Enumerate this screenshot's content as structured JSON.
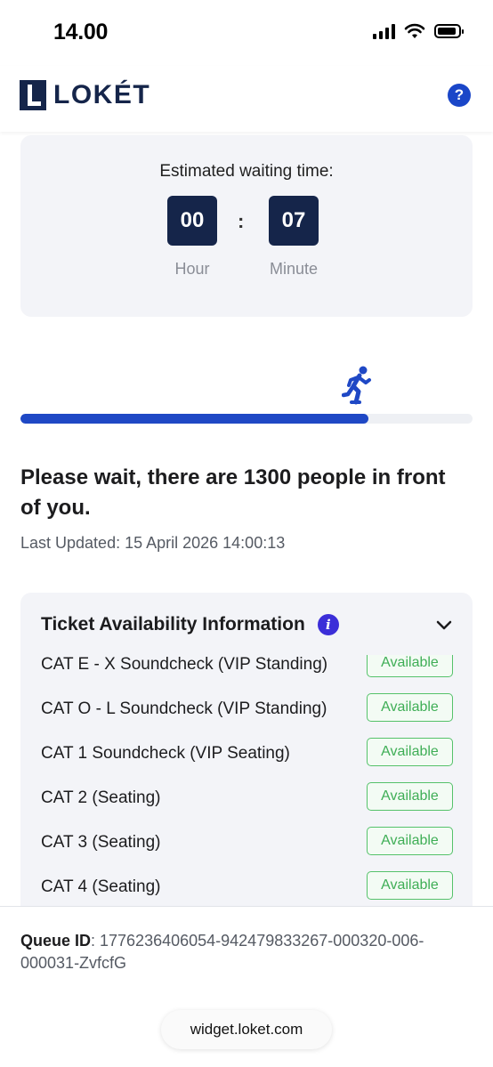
{
  "status_bar": {
    "time": "14.00"
  },
  "header": {
    "brand": "LOKÉT",
    "help_icon": "?"
  },
  "waiting": {
    "title": "Estimated waiting time:",
    "hours": "00",
    "minutes": "07",
    "separator": ":",
    "hour_label": "Hour",
    "minute_label": "Minute"
  },
  "progress": {
    "fraction": 0.77,
    "color": "#1f48c5"
  },
  "queue": {
    "message": "Please wait, there are 1300 people in front of you.",
    "last_updated": "Last Updated: 15 April 2026 14:00:13"
  },
  "tickets": {
    "title": "Ticket Availability Information",
    "info_icon": "i",
    "items": [
      {
        "name": "CAT E - X Soundcheck (VIP Standing)",
        "status": "Available"
      },
      {
        "name": "CAT O - L Soundcheck (VIP Standing)",
        "status": "Available"
      },
      {
        "name": "CAT 1 Soundcheck (VIP Seating)",
        "status": "Available"
      },
      {
        "name": "CAT 2 (Seating)",
        "status": "Available"
      },
      {
        "name": "CAT 3 (Seating)",
        "status": "Available"
      },
      {
        "name": "CAT 4 (Seating)",
        "status": "Available"
      }
    ]
  },
  "footer": {
    "queue_id_label": "Queue ID",
    "queue_id_value": ": 1776236406054-942479833267-000320-006-000031-ZvfcfG",
    "url": "widget.loket.com"
  },
  "colors": {
    "brand_navy": "#15254a",
    "accent_blue": "#1a46c8",
    "available_green": "#3fae56"
  }
}
